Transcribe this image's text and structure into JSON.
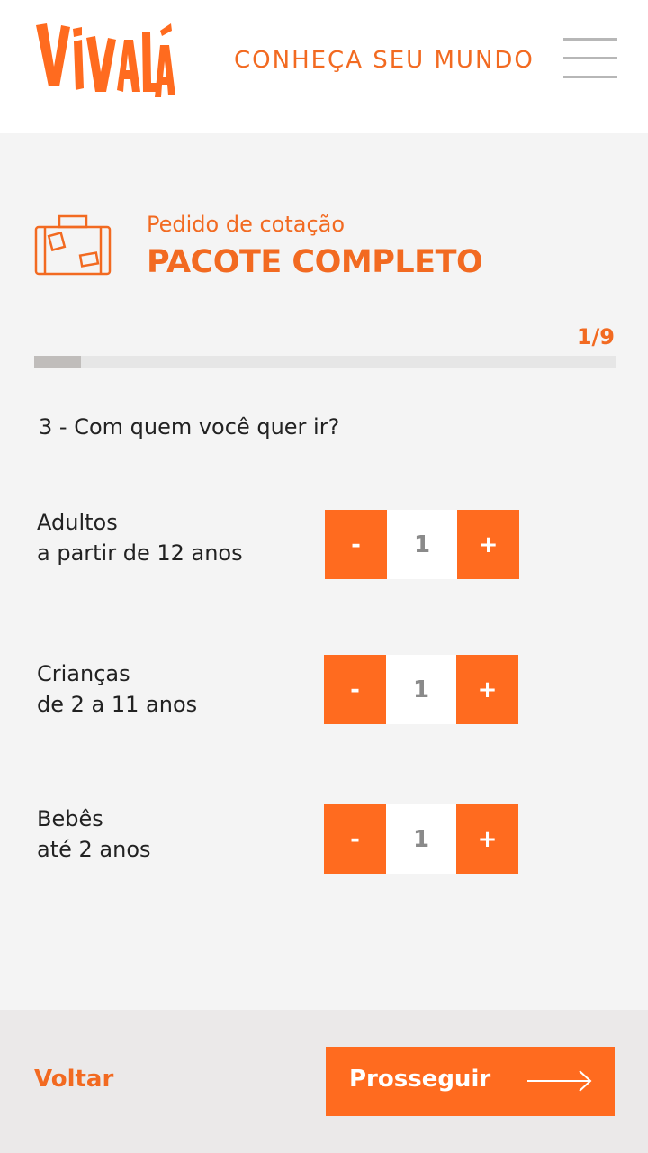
{
  "header": {
    "logo_text": "VIVALÁ",
    "tagline": "CONHEÇA SEU MUNDO",
    "menu_icon": "hamburger-menu-icon"
  },
  "quote": {
    "icon": "suitcase-icon",
    "subtitle": "Pedido de cotação",
    "title": "PACOTE COMPLETO"
  },
  "progress": {
    "label": "1/9",
    "fraction": 0.08
  },
  "question": "3 - Com quem você quer ir?",
  "travelers": [
    {
      "name": "Adultos",
      "desc": "a partir de 12 anos",
      "minus": "-",
      "value": "1",
      "plus": "+"
    },
    {
      "name": "Crianças",
      "desc": "de 2 a 11 anos",
      "minus": "-",
      "value": "1",
      "plus": "+"
    },
    {
      "name": "Bebês",
      "desc": "até 2 anos",
      "minus": "-",
      "value": "1",
      "plus": "+"
    }
  ],
  "footer": {
    "back_label": "Voltar",
    "next_label": "Prosseguir",
    "next_icon": "arrow-right-icon"
  },
  "colors": {
    "accent": "#ff6b1f",
    "brand_text": "#f26a21",
    "background": "#f4f4f4"
  }
}
